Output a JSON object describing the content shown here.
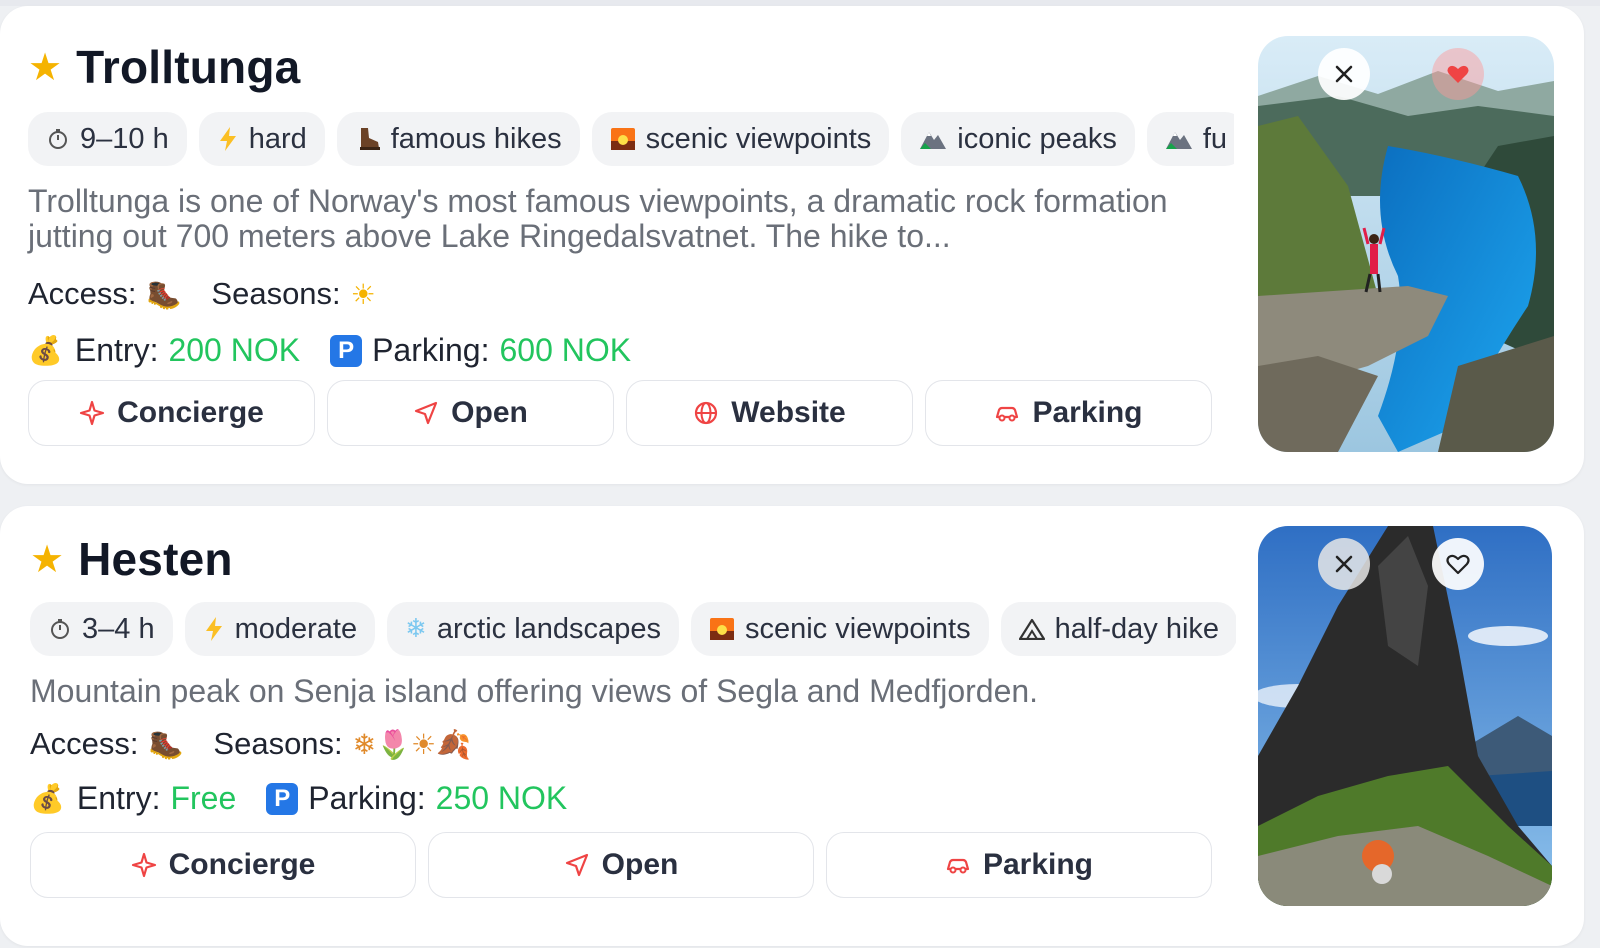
{
  "cards": [
    {
      "title": "Trolltunga",
      "tags": [
        {
          "icon": "stopwatch-icon",
          "label": "9–10 h"
        },
        {
          "icon": "lightning-icon",
          "label": "hard"
        },
        {
          "icon": "hiking-boot-icon",
          "label": "famous hikes"
        },
        {
          "icon": "sunset-icon",
          "label": "scenic viewpoints"
        },
        {
          "icon": "mountain-icon",
          "label": "iconic peaks"
        },
        {
          "icon": "mountain-icon",
          "label": "fu"
        }
      ],
      "description": "Trolltunga is one of Norway's most famous viewpoints, a dramatic rock formation jutting out 700 meters above Lake Ringedalsvatnet. The hike to...",
      "access_label": "Access:",
      "access_emojis": "🥾",
      "seasons_label": "Seasons:",
      "seasons_emojis": "☀",
      "entry_label": "Entry:",
      "entry_value": "200 NOK",
      "parking_label": "Parking:",
      "parking_value": "600 NOK",
      "parking_badge": "P",
      "buttons": [
        "Concierge",
        "Open",
        "Website",
        "Parking"
      ],
      "favorited": true
    },
    {
      "title": "Hesten",
      "tags": [
        {
          "icon": "stopwatch-icon",
          "label": "3–4 h"
        },
        {
          "icon": "lightning-icon",
          "label": "moderate"
        },
        {
          "icon": "snowflake-icon",
          "label": "arctic landscapes"
        },
        {
          "icon": "sunset-icon",
          "label": "scenic viewpoints"
        },
        {
          "icon": "mountain-icon",
          "label": "half-day hike"
        }
      ],
      "description": "Mountain peak on Senja island offering views of Segla and Medfjorden.",
      "access_label": "Access:",
      "access_emojis": "🥾",
      "seasons_label": "Seasons:",
      "seasons_emojis": "❄🌷☀🍂",
      "entry_label": "Entry:",
      "entry_value": "Free",
      "parking_label": "Parking:",
      "parking_value": "250 NOK",
      "parking_badge": "P",
      "buttons": [
        "Concierge",
        "Open",
        "Parking"
      ],
      "favorited": false
    }
  ],
  "colors": {
    "price_green": "#22c55e",
    "star": "#f5b301",
    "favorite_red": "#ef4444",
    "parking_badge_blue": "#2477e6",
    "concierge_red": "#ef4444"
  }
}
